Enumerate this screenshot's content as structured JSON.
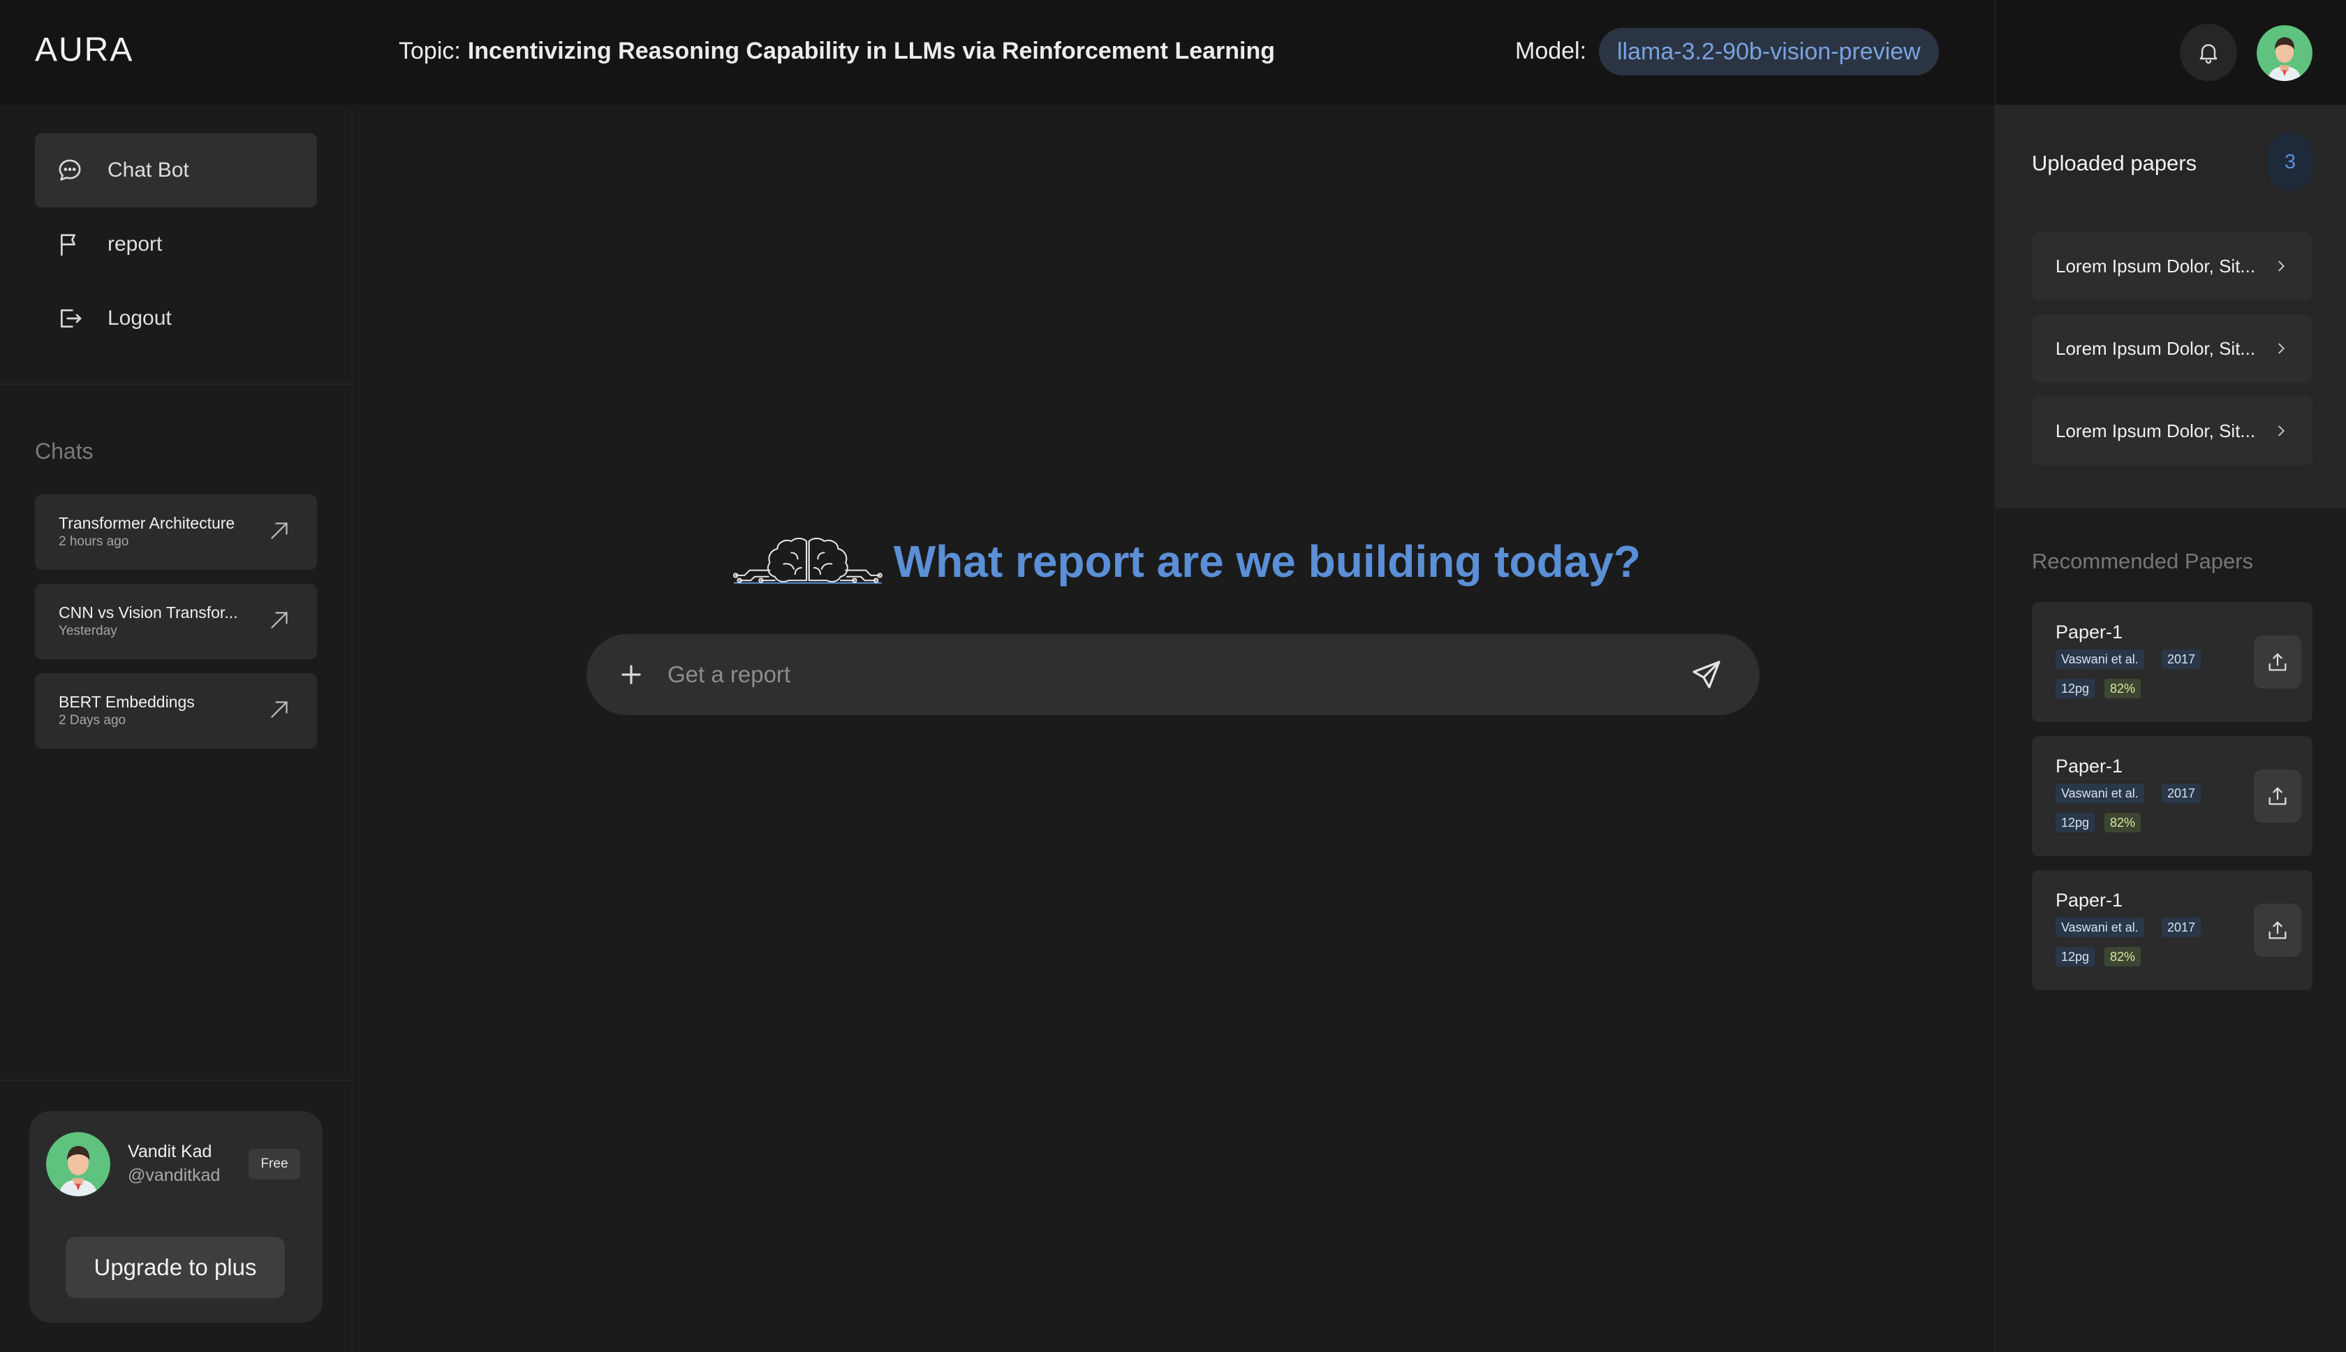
{
  "app": {
    "logo": "AURA"
  },
  "header": {
    "topic_label": "Topic:",
    "topic_value": "Incentivizing Reasoning Capability in LLMs via Reinforcement Learning",
    "model_label": "Model:",
    "model_value": "llama-3.2-90b-vision-preview"
  },
  "sidebar": {
    "nav": [
      {
        "label": "Chat Bot",
        "icon": "chat-bubble-icon",
        "active": true
      },
      {
        "label": "report",
        "icon": "flag-icon",
        "active": false
      },
      {
        "label": "Logout",
        "icon": "logout-icon",
        "active": false
      }
    ],
    "chats_heading": "Chats",
    "chats": [
      {
        "title": "Transformer Architecture",
        "time": "2 hours ago"
      },
      {
        "title": "CNN vs Vision Transfor...",
        "time": "Yesterday"
      },
      {
        "title": "BERT Embeddings",
        "time": "2 Days ago"
      }
    ],
    "profile": {
      "name": "Vandit Kad",
      "handle": "@vanditkad",
      "plan": "Free",
      "upgrade_label": "Upgrade to plus"
    }
  },
  "main": {
    "hero_title": "What report are we building today?",
    "search_placeholder": "Get a report"
  },
  "right_panel": {
    "uploaded_title": "Uploaded papers",
    "uploaded_count": "3",
    "uploaded": [
      {
        "title": "Lorem Ipsum Dolor, Sit..."
      },
      {
        "title": "Lorem Ipsum Dolor, Sit..."
      },
      {
        "title": "Lorem Ipsum Dolor, Sit..."
      }
    ],
    "recommended_title": "Recommended Papers",
    "recommended": [
      {
        "name": "Paper-1",
        "authors": "Vaswani et al.",
        "year": "2017",
        "pages": "12pg",
        "match": "82%"
      },
      {
        "name": "Paper-1",
        "authors": "Vaswani et al.",
        "year": "2017",
        "pages": "12pg",
        "match": "82%"
      },
      {
        "name": "Paper-1",
        "authors": "Vaswani et al.",
        "year": "2017",
        "pages": "12pg",
        "match": "82%"
      }
    ]
  },
  "colors": {
    "accent": "#5b8fd6",
    "background": "#1b1b1b",
    "panel": "#262626"
  }
}
